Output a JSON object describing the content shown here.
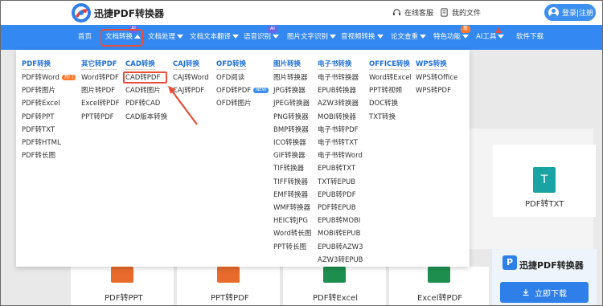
{
  "header": {
    "brand": "迅捷PDF转换器",
    "service_link": "在线客服",
    "files_link": "我的文件",
    "login_label": "登录|注册"
  },
  "nav": {
    "items": [
      {
        "label": "首页"
      },
      {
        "label": "文档转换",
        "badge": "AI",
        "active": true
      },
      {
        "label": "文档处理"
      },
      {
        "label": "文档文本翻译"
      },
      {
        "label": "语音识别",
        "badge": "AI"
      },
      {
        "label": "图片文字识别"
      },
      {
        "label": "音视频转换"
      },
      {
        "label": "论文查重"
      },
      {
        "label": "特色功能",
        "badge": "新"
      },
      {
        "label": "AI工具"
      },
      {
        "label": "软件下载"
      }
    ]
  },
  "dropdown": {
    "columns": [
      {
        "header": "PDF转换",
        "items": [
          "PDF转Word",
          "PDF转图片",
          "PDF转Excel",
          "PDF转PPT",
          "PDF转TXT",
          "PDF转HTML",
          "PDF转长图"
        ],
        "hot_index": 0,
        "hot_label": "热门"
      },
      {
        "header": "其它转PDF",
        "items": [
          "Word转PDF",
          "图片转PDF",
          "Excel转PDF",
          "PPT转PDF"
        ]
      },
      {
        "header": "CAD转换",
        "items": [
          "CAD转PDF",
          "CAD转图片",
          "PDF转CAD",
          "CAD版本转换"
        ]
      },
      {
        "header": "CAJ转换",
        "items": [
          "CAJ转Word",
          "CAJ转PDF"
        ]
      },
      {
        "header": "OFD转换",
        "items": [
          "OFD阅读",
          "OFD转PDF",
          "OFD转图片"
        ],
        "new_index": 1,
        "new_label": "NEW"
      },
      {
        "header": "图片转换",
        "items": [
          "图片转换器",
          "JPG转换器",
          "JPEG转换器",
          "PNG转换器",
          "BMP转换器",
          "ICO转换器",
          "GIF转换器",
          "TIF转换器",
          "TIFF转换器",
          "EMF转换器",
          "WMF转换器",
          "HEIC转JPG",
          "Word转长图",
          "PPT转长图"
        ]
      },
      {
        "header": "电子书转换",
        "items": [
          "电子书转换器",
          "EPUB转换器",
          "AZW3转换器",
          "MOBI转换器",
          "电子书转PDF",
          "电子书转TXT",
          "电子书转Word",
          "EPUB转TXT",
          "TXT转EPUB",
          "EPUB转PDF",
          "PDF转EPUB",
          "EPUB转MOBI",
          "MOBI转EPUB",
          "EPUB转AZW3",
          "AZW3转EPUB"
        ]
      },
      {
        "header": "OFFICE转换",
        "items": [
          "Word转Excel",
          "PPT转视频",
          "DOC转换",
          "TXT转换"
        ]
      },
      {
        "header": "WPS转换",
        "items": [
          "WPS转Office",
          "WPS转PDF"
        ]
      }
    ]
  },
  "background": {
    "cards": [
      {
        "label": "PDF转TXT",
        "icon_letter": "T",
        "color": "#1aa3a3"
      },
      {
        "label": "PDF转PPT",
        "color": "#e86a2c"
      },
      {
        "label": "PPT转PDF",
        "color": "#e86a2c"
      },
      {
        "label": "PDF转Excel",
        "color": "#1e8e4e"
      },
      {
        "label": "Excel转PDF",
        "color": "#1e8e4e"
      }
    ],
    "promo_title": "迅捷PDF转换器",
    "promo_logo_letter": "P",
    "download_label": "立即下载"
  },
  "colors": {
    "nav_blue": "#3388f2",
    "accent_red": "#e74f3a",
    "column_header": "#1f6fd8"
  }
}
